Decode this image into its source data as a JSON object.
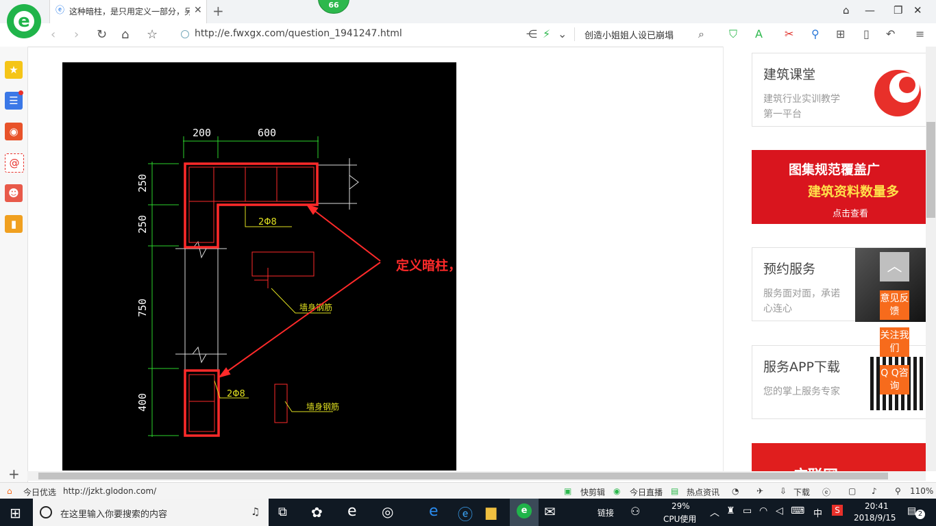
{
  "browser": {
    "tab_title": "这种暗柱，是只用定义一部分，另",
    "badge_count": "66",
    "url": "http://e.fwxgx.com/question_1941247.html",
    "search_text": "创造小姐姐人设已崩塌",
    "status_url": "http://jzkt.glodon.com/",
    "status_left": "今日优选",
    "status_items": [
      "快剪辑",
      "今日直播",
      "热点资讯",
      "下载"
    ],
    "zoom": "110%"
  },
  "cad": {
    "dim_top_1": "200",
    "dim_top_2": "600",
    "dim_left_1": "250",
    "dim_left_2": "250",
    "dim_left_3": "750",
    "dim_left_4": "400",
    "rebar_label_1": "2Φ8",
    "rebar_label_2": "2Φ8",
    "wall_rebar_label_1": "墙身钢筋",
    "wall_rebar_label_2": "墙身钢筋",
    "annotation": "定义暗柱，用剪力墙覆盖"
  },
  "sidebar": {
    "cards": [
      {
        "title": "建筑课堂",
        "subtitle": "建筑行业实训教学第一平台"
      },
      {
        "title": "预约服务",
        "subtitle": "服务面对面，承诺心连心"
      },
      {
        "title": "服务APP下载",
        "subtitle": "您的掌上服务专家"
      }
    ],
    "banner": {
      "line1": "图集规范覆盖广",
      "line2": "建筑资料数量多",
      "line3": "点击查看"
    },
    "bottom_banner": "广联网"
  },
  "float_buttons": {
    "feedback": "意见反馈",
    "follow": "关注我们",
    "qq": "Q Q咨询"
  },
  "taskbar": {
    "search_placeholder": "在这里输入你要搜索的内容",
    "link_label": "链接",
    "cpu_percent": "29%",
    "cpu_label": "CPU使用",
    "ime": "中",
    "time": "20:41",
    "date": "2018/9/15",
    "notifications": "2"
  },
  "colors": {
    "accent_green": "#20b44a",
    "orange": "#f76b1c",
    "cad_red": "#ff2a2a",
    "cad_green": "#2cd52c"
  }
}
